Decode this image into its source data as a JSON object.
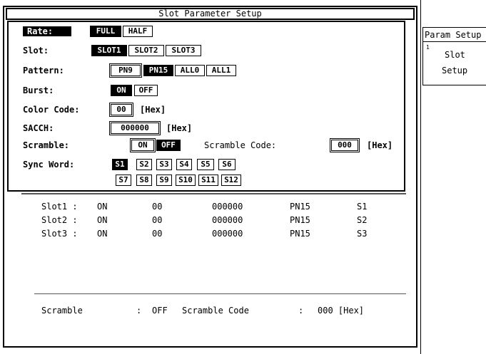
{
  "window": {
    "title": "Slot Parameter Setup"
  },
  "setup": {
    "rate": {
      "label": "Rate:",
      "options": [
        "FULL",
        "HALF"
      ],
      "selected": "FULL"
    },
    "slot": {
      "label": "Slot:",
      "options": [
        "SLOT1",
        "SLOT2",
        "SLOT3"
      ],
      "selected": "SLOT1"
    },
    "pattern": {
      "label": "Pattern:",
      "options": [
        "PN9",
        "PN15",
        "ALL0",
        "ALL1"
      ],
      "selected": "PN15"
    },
    "burst": {
      "label": "Burst:",
      "options": [
        "ON",
        "OFF"
      ],
      "selected": "ON"
    },
    "color_code": {
      "label": "Color Code:",
      "value": "00",
      "unit": "[Hex]"
    },
    "sacch": {
      "label": "SACCH:",
      "value": "000000",
      "unit": "[Hex]"
    },
    "scramble": {
      "label": "Scramble:",
      "options": [
        "ON",
        "OFF"
      ],
      "selected": "OFF"
    },
    "scramble_code": {
      "label": "Scramble Code:",
      "value": "000",
      "unit": "[Hex]"
    },
    "sync_word": {
      "label": "Sync Word:",
      "row1": [
        "S1",
        "S2",
        "S3",
        "S4",
        "S5",
        "S6"
      ],
      "row2": [
        "S7",
        "S8",
        "S9",
        "S10",
        "S11",
        "S12"
      ],
      "selected": "S1"
    }
  },
  "summary": {
    "rows": [
      {
        "slot": "Slot1 :",
        "burst": "ON",
        "color": "00",
        "sacch": "000000",
        "pattern": "PN15",
        "sync": "S1"
      },
      {
        "slot": "Slot2 :",
        "burst": "ON",
        "color": "00",
        "sacch": "000000",
        "pattern": "PN15",
        "sync": "S2"
      },
      {
        "slot": "Slot3 :",
        "burst": "ON",
        "color": "00",
        "sacch": "000000",
        "pattern": "PN15",
        "sync": "S3"
      }
    ],
    "footer": {
      "scramble_label": "Scramble",
      "scramble_sep": ":",
      "scramble_value": "OFF",
      "code_label": "Scramble Code",
      "code_sep": ":",
      "code_value": "000 [Hex]"
    }
  },
  "side_menu": {
    "title": "Param Setup",
    "item": {
      "number": "1",
      "line1": "Slot",
      "line2": "Setup"
    }
  }
}
